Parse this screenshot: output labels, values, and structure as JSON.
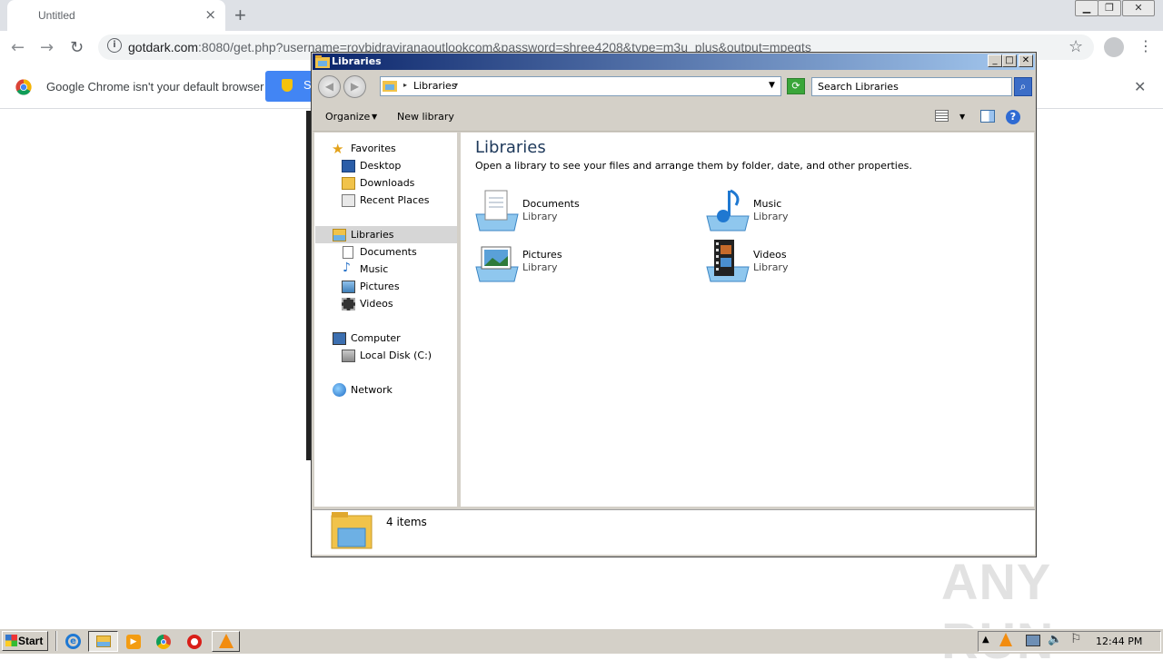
{
  "chrome": {
    "tab_title": "Untitled",
    "tab_close": "×",
    "new_tab": "+",
    "url_host": "gotdark.com",
    "url_rest": ":8080/get.php?username=roybidraviranaoutlookcom&password=shree4208&type=m3u_plus&output=mpegts",
    "infobar_text": "Google Chrome isn't your default browser",
    "infobar_button_text": "S",
    "infobar_close": "✕"
  },
  "explorer": {
    "title": "Libraries",
    "address": "Libraries",
    "search_placeholder": "Search Libraries",
    "toolbar": {
      "organize": "Organize",
      "new_library": "New library"
    },
    "nav": {
      "favorites": {
        "label": "Favorites",
        "items": [
          "Desktop",
          "Downloads",
          "Recent Places"
        ]
      },
      "libraries": {
        "label": "Libraries",
        "items": [
          "Documents",
          "Music",
          "Pictures",
          "Videos"
        ]
      },
      "computer": {
        "label": "Computer",
        "items": [
          "Local Disk (C:)"
        ]
      },
      "network": {
        "label": "Network"
      }
    },
    "content": {
      "title": "Libraries",
      "description": "Open a library to see your files and arrange them by folder, date, and other properties.",
      "libraries": [
        {
          "name": "Documents",
          "sub": "Library"
        },
        {
          "name": "Music",
          "sub": "Library"
        },
        {
          "name": "Pictures",
          "sub": "Library"
        },
        {
          "name": "Videos",
          "sub": "Library"
        }
      ]
    },
    "status": "4 items"
  },
  "taskbar": {
    "start": "Start",
    "clock": "12:44 PM"
  },
  "watermark": "ANY RUN",
  "colors": {
    "chrome_blue": "#4285f4",
    "title_bar": "#0a246a",
    "content_title": "#1e395b"
  }
}
